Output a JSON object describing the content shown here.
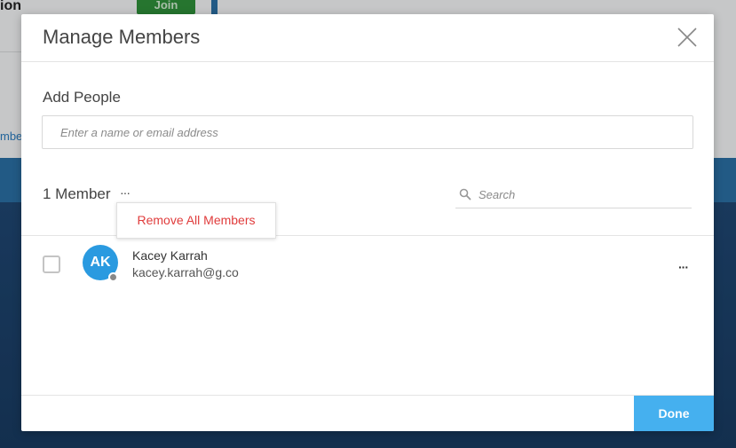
{
  "background": {
    "title_fragment": "ion",
    "join_label": "Join",
    "members_fragment": "mbe"
  },
  "modal": {
    "title": "Manage Members",
    "close_icon": "close-icon",
    "add_people": {
      "label": "Add People",
      "placeholder": "Enter a name or email address",
      "value": ""
    },
    "members_header": {
      "count_label": "1 Member",
      "more_glyph": "···",
      "search_placeholder": "Search",
      "search_icon": "search-icon"
    },
    "dropdown": {
      "items": [
        "Remove All Members"
      ]
    },
    "members": [
      {
        "initials": "AK",
        "name": "Kacey Karrah",
        "email": "kacey.karrah@g.co",
        "more_glyph": "···",
        "selected": false
      }
    ],
    "footer": {
      "done_label": "Done"
    }
  },
  "colors": {
    "accent": "#45b0ef",
    "avatar": "#2a9ae0",
    "danger": "#e03c3c",
    "join_green": "#2f8f3a",
    "background_dark": "#1d3f66"
  }
}
